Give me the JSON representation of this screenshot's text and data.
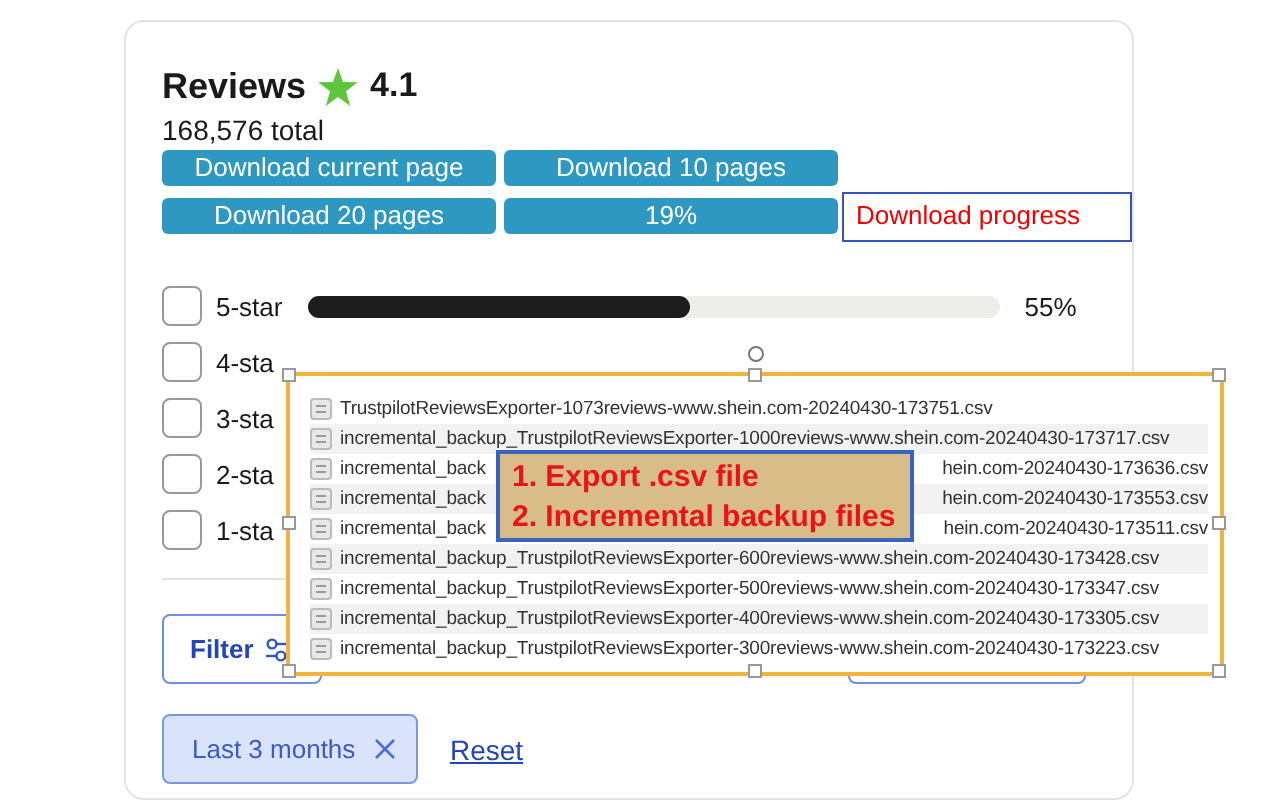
{
  "header": {
    "title": "Reviews",
    "rating": "4.1",
    "total": "168,576 total"
  },
  "download_buttons": [
    {
      "label": "Download current page"
    },
    {
      "label": "Download 10 pages"
    },
    {
      "label": "Download 20 pages"
    },
    {
      "label": "19%"
    }
  ],
  "progress_note": "Download progress",
  "star_rows": [
    {
      "label": "5-star",
      "checked": false,
      "level": 0.55,
      "percent": "55%"
    },
    {
      "label": "4-sta",
      "checked": false
    },
    {
      "label": "3-sta",
      "checked": false
    },
    {
      "label": "2-sta",
      "checked": false
    },
    {
      "label": "1-sta",
      "checked": false
    }
  ],
  "filter_button": "Filter",
  "active_filters": [
    {
      "label": "Last 3 months"
    }
  ],
  "reset_link": "Reset",
  "file_list": {
    "files": [
      {
        "parts": [
          "TrustpilotReviewsExporter-1073reviews-www.shein.com-20240430-173751.csv"
        ]
      },
      {
        "parts": [
          "incremental_backup_TrustpilotReviewsExporter-1000reviews-www.shein.com-20240430-173717.csv"
        ]
      },
      {
        "parts": [
          "incremental_back",
          "hein.com-20240430-173636.csv"
        ]
      },
      {
        "parts": [
          "incremental_back",
          "hein.com-20240430-173553.csv"
        ]
      },
      {
        "parts": [
          "incremental_back",
          "hein.com-20240430-173511.csv"
        ]
      },
      {
        "parts": [
          "incremental_backup_TrustpilotReviewsExporter-600reviews-www.shein.com-20240430-173428.csv"
        ]
      },
      {
        "parts": [
          "incremental_backup_TrustpilotReviewsExporter-500reviews-www.shein.com-20240430-173347.csv"
        ]
      },
      {
        "parts": [
          "incremental_backup_TrustpilotReviewsExporter-400reviews-www.shein.com-20240430-173305.csv"
        ]
      },
      {
        "parts": [
          "incremental_backup_TrustpilotReviewsExporter-300reviews-www.shein.com-20240430-173223.csv"
        ]
      }
    ],
    "note": [
      "1. Export .csv file",
      "2. Incremental backup files"
    ]
  }
}
